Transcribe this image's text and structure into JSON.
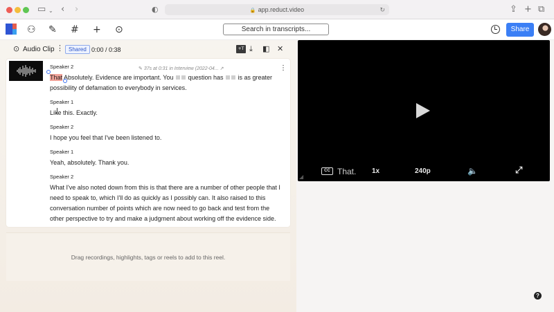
{
  "browser": {
    "url": "app.reduct.video",
    "icons": {
      "sidebar": "sidebar-icon",
      "back": "chevron-left-icon",
      "forward": "chevron-right-icon",
      "shield": "shield-icon",
      "reload": "reload-icon",
      "share": "share-icon",
      "new_tab": "plus-icon",
      "tabs": "tabs-icon"
    }
  },
  "toolbar": {
    "search_label": "Search in transcripts...",
    "share_label": "Share",
    "icons": [
      "projects-icon",
      "highlight-icon",
      "tags-icon",
      "add-icon",
      "search-reel-icon",
      "history-icon"
    ]
  },
  "clip": {
    "title": "Audio Clip",
    "shared_badge": "Shared",
    "time": "0:00 / 0:38",
    "meta": "37s at 0:31 in Interview (2022-04...",
    "segments": [
      {
        "speaker": "Speaker 2",
        "parts": [
          {
            "t": "That",
            "hl": true
          },
          {
            "t": " Absolutely. Evidence are important. You "
          },
          {
            "blank": 2
          },
          {
            "t": " question has "
          },
          {
            "blank": 2
          },
          {
            "t": " is as greater possibility of defamation to everybody in services."
          }
        ]
      },
      {
        "speaker": "Speaker 1",
        "text": "Like this. Exactly."
      },
      {
        "speaker": "Speaker 2",
        "text": "I hope you feel that I've been listened to."
      },
      {
        "speaker": "Speaker 1",
        "text": "Yeah, absolutely. Thank you."
      },
      {
        "speaker": "Speaker 2",
        "text": "What I've also noted down from this is that there are a number of other people that I need to speak to, which I'll do as quickly as I possibly can. It also raised to this conversation number of points which are now need to go back and test from the other perspective to try and make a judgment about working off the evidence side."
      }
    ],
    "dropzone_text": "Drag recordings, highlights, tags or reels to add to this reel."
  },
  "video": {
    "cc_label": "CC",
    "caption": "That.",
    "speed": "1x",
    "quality": "240p"
  },
  "help_label": "?"
}
